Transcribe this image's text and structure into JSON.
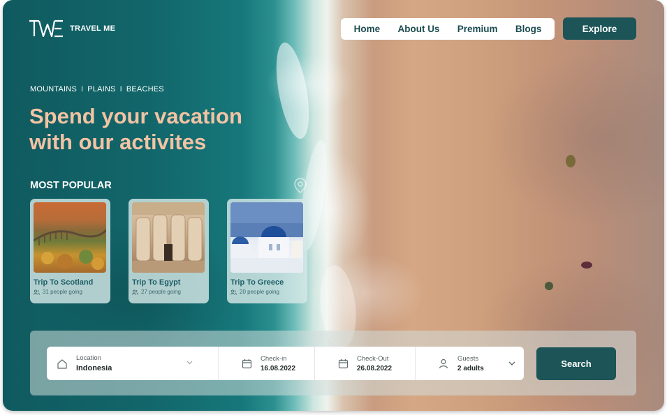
{
  "brand": {
    "logo_mark": "TWE logo",
    "name": "TRAVEL ME"
  },
  "nav": {
    "items": [
      "Home",
      "About Us",
      "Premium",
      "Blogs"
    ]
  },
  "explore_label": "Explore",
  "hero": {
    "tags": [
      "MOUNTAINS",
      "PLAINS",
      "BEACHES"
    ],
    "tag_separator": "I",
    "headline_line1": "Spend your vacation",
    "headline_line2": "with our activites"
  },
  "most_popular": {
    "title": "MOST POPULAR",
    "cards": [
      {
        "title": "Trip To Scotland",
        "meta": "31 people going",
        "icon": "users-icon"
      },
      {
        "title": "Trip To Egypt",
        "meta": "27 people going",
        "icon": "users-icon"
      },
      {
        "title": "Trip To Greece",
        "meta": "20 people going",
        "icon": "users-icon"
      }
    ]
  },
  "search": {
    "location": {
      "label": "Location",
      "value": "Indonesia",
      "icon": "home-icon"
    },
    "checkin": {
      "label": "Check-in",
      "value": "16.08.2022",
      "icon": "calendar-icon"
    },
    "checkout": {
      "label": "Check-Out",
      "value": "26.08.2022",
      "icon": "calendar-icon"
    },
    "guests": {
      "label": "Guests",
      "value": "2 adults",
      "icon": "user-icon"
    },
    "button_label": "Search"
  },
  "colors": {
    "accent": "#1c5457",
    "headline": "#f2c3a4",
    "card_title": "#1e5e66"
  }
}
